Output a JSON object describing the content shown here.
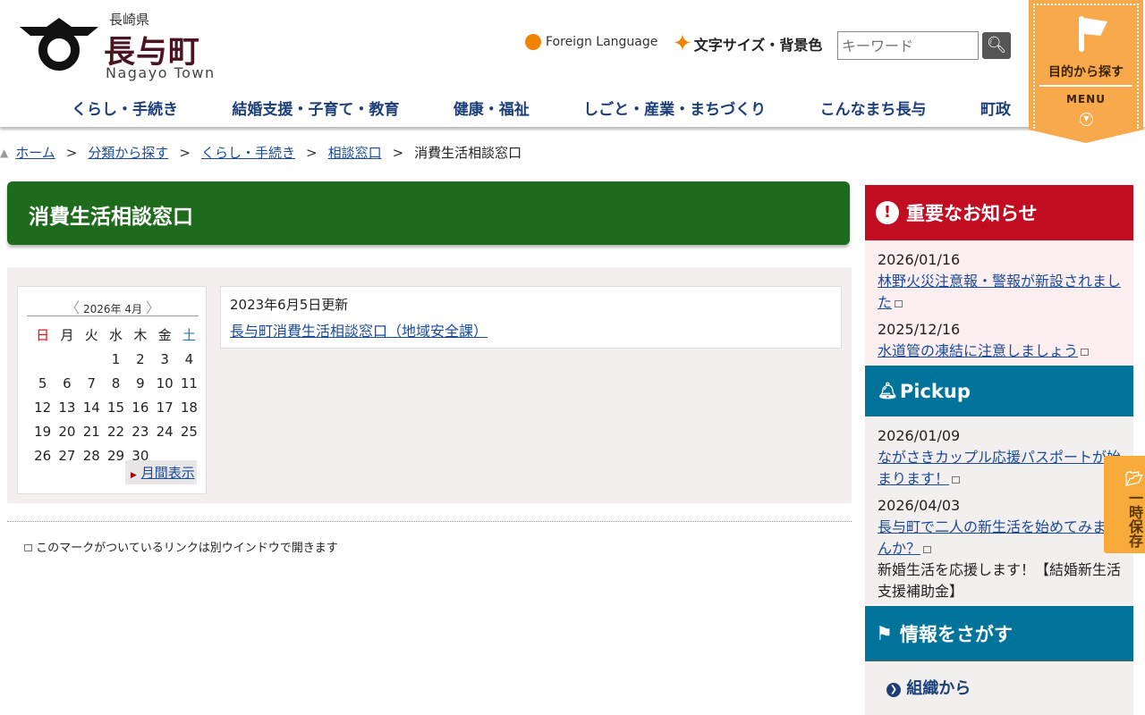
{
  "header": {
    "prefecture": "長崎県",
    "town": "長与町",
    "town_en": "Nagayo Town",
    "foreign_language": "Foreign Language",
    "font_size_bg": "文字サイズ・背景色",
    "search_placeholder": "キーワード",
    "menu_title": "目的から探す",
    "menu_label": "MENU"
  },
  "nav": [
    "くらし・手続き",
    "結婚支援・子育て・教育",
    "健康・福祉",
    "しごと・産業・まちづくり",
    "こんなまち長与",
    "町政"
  ],
  "breadcrumb": [
    "ホーム",
    "分類から探す",
    "くらし・手続き",
    "相談窓口"
  ],
  "breadcrumb_current": "消費生活相談窓口",
  "page_title": "消費生活相談窓口",
  "calendar": {
    "title": "2026年 4月",
    "weekdays": [
      "日",
      "月",
      "火",
      "水",
      "木",
      "金",
      "土"
    ],
    "weeks": [
      [
        "",
        "",
        "",
        "1",
        "2",
        "3",
        "4"
      ],
      [
        "5",
        "6",
        "7",
        "8",
        "9",
        "10",
        "11"
      ],
      [
        "12",
        "13",
        "14",
        "15",
        "16",
        "17",
        "18"
      ],
      [
        "19",
        "20",
        "21",
        "22",
        "23",
        "24",
        "25"
      ],
      [
        "26",
        "27",
        "28",
        "29",
        "30",
        "",
        ""
      ]
    ],
    "month_view": "月間表示"
  },
  "article": {
    "updated": "2023年6月5日更新",
    "link": "長与町消費生活相談窓口（地域安全課）"
  },
  "external_note": "このマークがついているリンクは別ウインドウで開きます",
  "important": {
    "title": "重要なお知らせ",
    "items": [
      {
        "date": "2026/01/16",
        "text": "林野火災注意報・警報が新設されました"
      },
      {
        "date": "2025/12/16",
        "text": "水道管の凍結に注意しましょう"
      }
    ]
  },
  "pickup": {
    "title": "Pickup",
    "items": [
      {
        "date": "2026/01/09",
        "text": "ながさきカップル応援パスポートが始まります！"
      },
      {
        "date": "2026/04/03",
        "text": "長与町で二人の新生活を始めてみませんか？",
        "desc": "新婚生活を応援します！【結婚新生活支援補助金】"
      }
    ]
  },
  "info": {
    "title": "情報をさがす",
    "items": [
      "組織から"
    ]
  },
  "save_tab": "一時保存",
  "colors": {
    "green": "#1e6b1e",
    "red": "#c20c22",
    "teal": "#00739b",
    "orange": "#f7a94c"
  }
}
